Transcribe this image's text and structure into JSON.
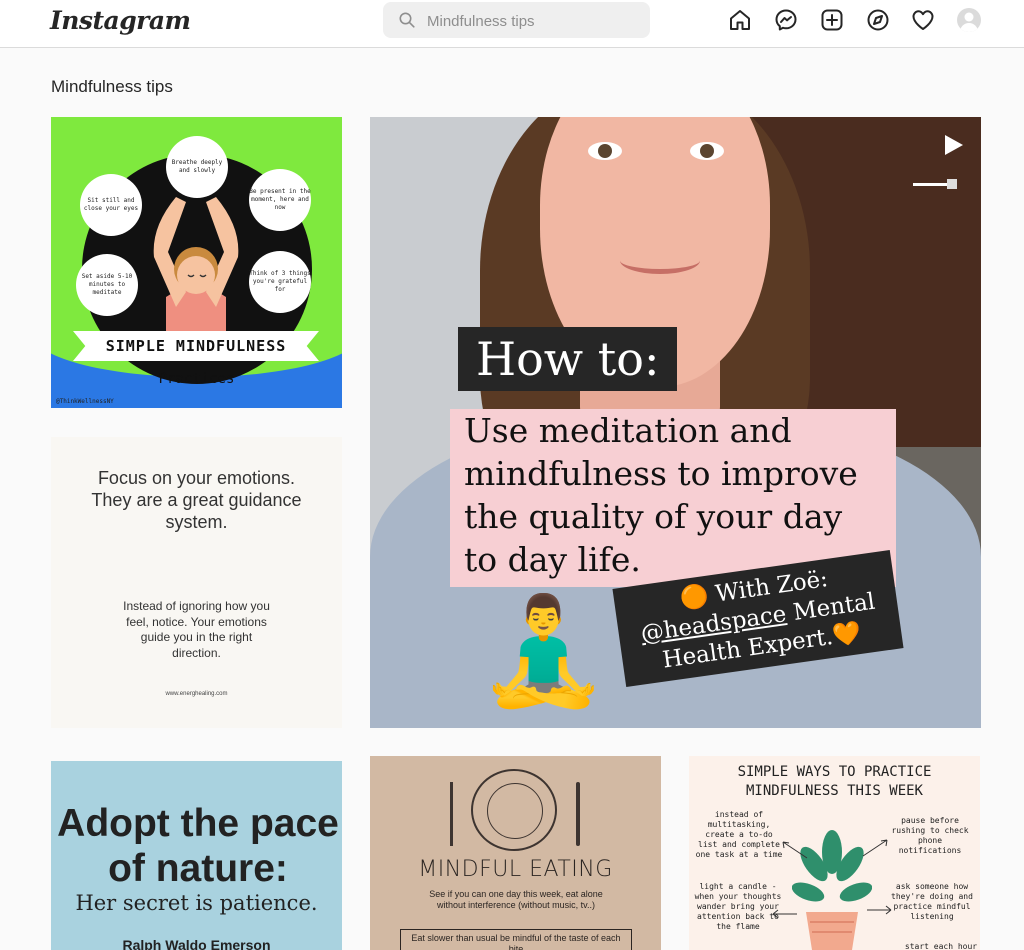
{
  "header": {
    "logo": "Instagram",
    "search": {
      "placeholder": "Mindfulness tips"
    },
    "nav_icons": [
      "home-icon",
      "messenger-icon",
      "new-post-icon",
      "explore-icon",
      "activity-heart-icon",
      "avatar"
    ]
  },
  "page": {
    "title": "Mindfulness tips"
  },
  "posts": {
    "p1": {
      "bubbles": [
        "Breathe deeply and slowly",
        "Sit still and close your eyes",
        "Be present in the moment, here and now",
        "Set aside 5-10 minutes to meditate",
        "Think of 3 things you're grateful for"
      ],
      "banner": "SIMPLE MINDFULNESS",
      "subtitle": "Practices",
      "handle": "@ThinkWellnessNY"
    },
    "p2": {
      "quote": "Focus on your emotions. They are a great guidance system.",
      "sub": "Instead of ignoring how you feel, notice. Your emotions guide you in the right direction.",
      "source": "www.energhealing.com"
    },
    "p3": {
      "h1": "How to:",
      "h2": "Use meditation and mindfulness to improve the quality of your day to day life.",
      "h3_pre": "🟠 With Zoë:",
      "h3_link": "@headspace",
      "h3_post": " Mental Health Expert.🧡",
      "emoji": "🧘‍♂️"
    },
    "p4": {
      "big": "Adopt the pace of nature:",
      "sub": "Her secret is patience.",
      "author": "Ralph Waldo Emerson"
    },
    "p5": {
      "title": "MINDFUL EATING",
      "desc": "See if you can one day this week, eat alone without interference (without music, tv..)",
      "box": "Eat slower than usual be mindful of the taste of each bite"
    },
    "p6": {
      "title": "SIMPLE WAYS TO PRACTICE MINDFULNESS THIS WEEK",
      "n1": "instead of multitasking, create a to-do list and complete one task at a time",
      "n2": "pause before rushing to check phone notifications",
      "n3": "light a candle - when your thoughts wander bring your attention back to the flame",
      "n4": "ask someone how they're doing and practice mindful listening",
      "n5": "start each hour"
    }
  },
  "colors": {
    "accent": "#262626",
    "border": "#dbdbdb",
    "bg": "#fafafa"
  }
}
